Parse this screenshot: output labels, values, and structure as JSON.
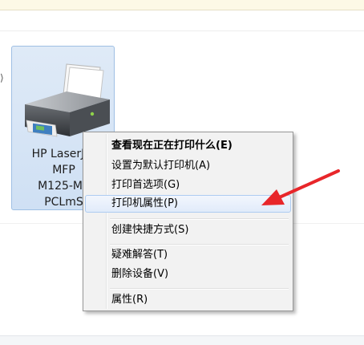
{
  "device": {
    "label_lines": [
      "HP LaserJet",
      "MFP",
      "M125-M1",
      "PCLmS"
    ]
  },
  "context_menu": {
    "items": [
      {
        "label": "查看现在正在打印什么(E)"
      },
      {
        "label": "设置为默认打印机(A)"
      },
      {
        "label": "打印首选项(G)"
      },
      {
        "label": "打印机属性(P)"
      },
      {
        "label": "创建快捷方式(S)"
      },
      {
        "label": "疑难解答(T)"
      },
      {
        "label": "删除设备(V)"
      },
      {
        "label": "属性(R)"
      }
    ],
    "highlighted_item": "打印机属性(P)"
  },
  "annotation": {
    "color": "#e8262a"
  },
  "colors": {
    "selection_fill": "#cfe0f4",
    "selection_border": "#9fbfe4",
    "menu_bg": "#f2f2f2"
  }
}
